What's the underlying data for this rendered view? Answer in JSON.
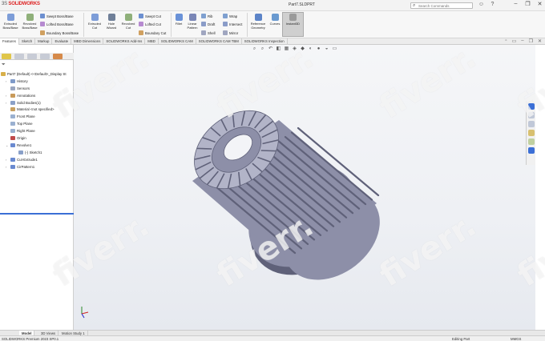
{
  "app": {
    "logo_prefix": "3S",
    "logo_main": "SOLIDWORKS",
    "document_title": "Part7.SLDPRT",
    "search_placeholder": "Search Commands"
  },
  "ribbon": {
    "extruded_boss": "Extruded Boss/Base",
    "revolved_boss": "Revolved Boss/Base",
    "swept_boss": "Swept Boss/Base",
    "lofted_boss": "Lofted Boss/Base",
    "boundary_boss": "Boundary Boss/Base",
    "extruded_cut": "Extruded Cut",
    "hole_wizard": "Hole Wizard",
    "revolved_cut": "Revolved Cut",
    "swept_cut": "Swept Cut",
    "lofted_cut": "Lofted Cut",
    "boundary_cut": "Boundary Cut",
    "fillet": "Fillet",
    "linear_pattern": "Linear Pattern",
    "rib": "Rib",
    "draft": "Draft",
    "shell": "Shell",
    "wrap": "Wrap",
    "intersect": "Intersect",
    "mirror": "Mirror",
    "reference_geometry": "Reference Geometry",
    "curves": "Curves",
    "instant3d": "Instant3D"
  },
  "tabs": [
    "Features",
    "Sketch",
    "Markup",
    "Evaluate",
    "MBD Dimensions",
    "SOLIDWORKS Add-Ins",
    "MBD",
    "SOLIDWORKS CAM",
    "SOLIDWORKS CAM TBM",
    "SOLIDWORKS Inspection"
  ],
  "tree": {
    "root": "Part7 (Default) <<Default>_Display St",
    "items": [
      {
        "label": "History",
        "level": 0,
        "exp": "›"
      },
      {
        "label": "Sensors",
        "level": 0,
        "exp": ""
      },
      {
        "label": "Annotations",
        "level": 0,
        "exp": "›"
      },
      {
        "label": "Solid Bodies(1)",
        "level": 0,
        "exp": "›"
      },
      {
        "label": "Material <not specified>",
        "level": 0,
        "exp": ""
      },
      {
        "label": "Front Plane",
        "level": 0,
        "exp": ""
      },
      {
        "label": "Top Plane",
        "level": 0,
        "exp": ""
      },
      {
        "label": "Right Plane",
        "level": 0,
        "exp": ""
      },
      {
        "label": "Origin",
        "level": 0,
        "exp": ""
      },
      {
        "label": "Revolve1",
        "level": 0,
        "exp": "⌄"
      },
      {
        "label": "(-) Sketch1",
        "level": 1,
        "exp": ""
      },
      {
        "label": "Cut-Extrude1",
        "level": 0,
        "exp": "›"
      },
      {
        "label": "CirPattern1",
        "level": 0,
        "exp": "›"
      }
    ]
  },
  "model_tabs": [
    "Model",
    "3D Views",
    "Motion Study 1"
  ],
  "status": {
    "left": "SOLIDWORKS Premium 2023 SP0.1",
    "mode": "Editing Part",
    "units": "MMGS"
  },
  "watermark_text": "fiverr.",
  "colors": {
    "part": "#8d8fa8",
    "part_dark": "#5f6179",
    "part_light": "#b2b4c8",
    "accent": "#3b6fd6",
    "logo": "#d22222"
  }
}
